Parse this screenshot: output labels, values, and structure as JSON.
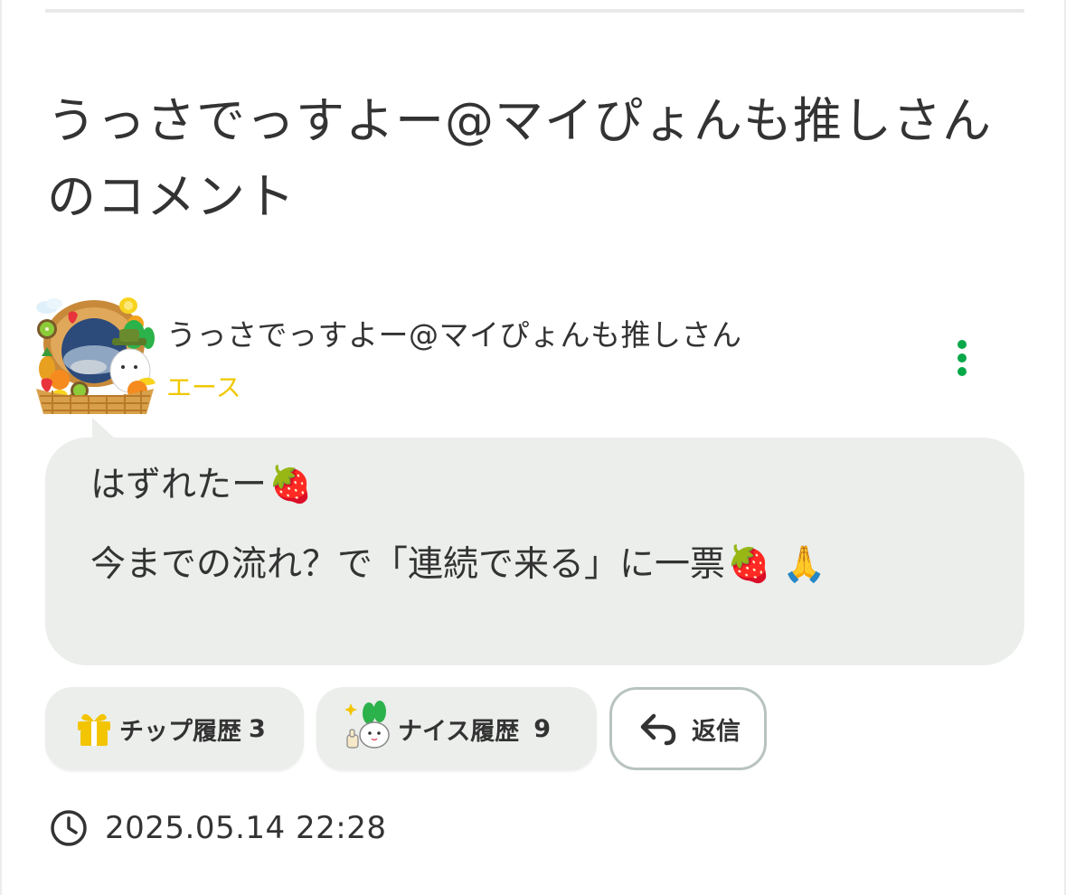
{
  "page": {
    "title": "うっさでっすよー@マイぴょんも推しさんのコメント"
  },
  "comment": {
    "user_name": "うっさでっすよー@マイぴょんも推しさん",
    "user_rank": "エース",
    "lines": [
      "はずれたー",
      "今までの流れ？で「連続で来る」に一票"
    ],
    "line_emojis": [
      "🍓",
      "🍓 🙏"
    ],
    "timestamp": "2025.05.14 22:28"
  },
  "actions": {
    "tip_label": "チップ履歴",
    "tip_count": "3",
    "nice_label": "ナイス履歴",
    "nice_count": "9",
    "reply_label": "返信"
  },
  "colors": {
    "accent_green": "#08a848",
    "rank_yellow": "#f0c800",
    "bubble_bg": "#ebeeeb",
    "text": "#333333"
  },
  "icons": {
    "avatar": "avatar-fruit-basket",
    "more": "more-vertical-icon",
    "tip": "gift-icon",
    "nice": "nice-mascot-icon",
    "reply": "reply-arrow-icon",
    "time": "clock-icon"
  }
}
